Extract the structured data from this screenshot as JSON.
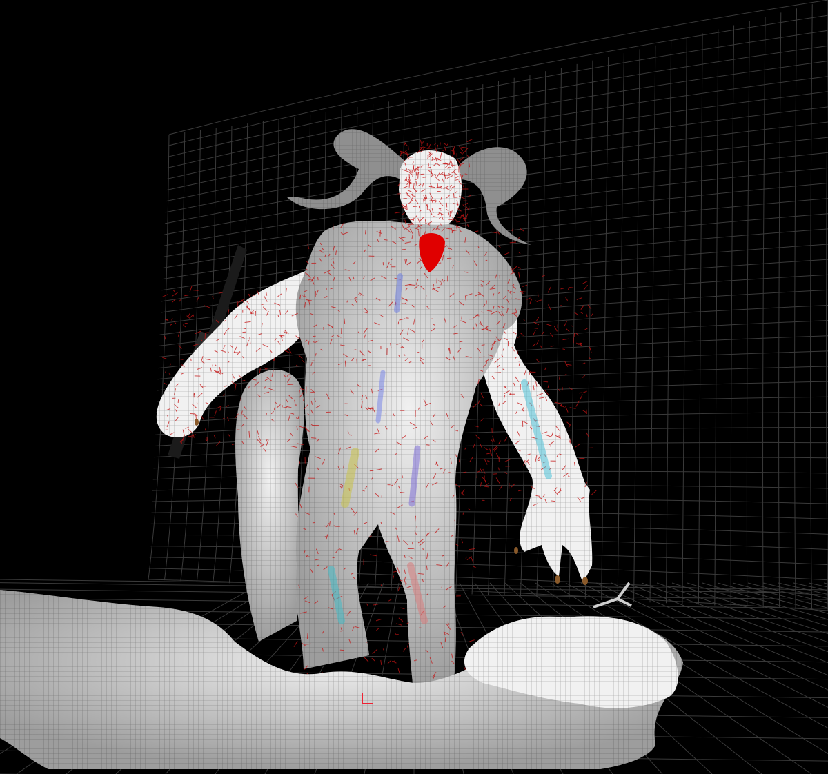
{
  "viewport": {
    "background": "#000000",
    "grid_color": "#3a3a3a",
    "mesh_color": "#f2f2f2",
    "wire_color": "#8a8a8a",
    "hair_color": "#c41414",
    "horn_color": "#8c8c8c",
    "tongue_color": "#e00000",
    "weapon_color": "#1e1e1e"
  },
  "scene": {
    "objects": [
      {
        "name": "backdrop",
        "icon": "cyclorama-grid"
      },
      {
        "name": "floor-grid",
        "icon": "grid-plane"
      },
      {
        "name": "demon",
        "icon": "wireframe-figure"
      },
      {
        "name": "horns",
        "icon": "curled-horn"
      },
      {
        "name": "tongue",
        "icon": "tongue"
      },
      {
        "name": "weapon",
        "icon": "club"
      },
      {
        "name": "rock-pillar",
        "icon": "rock"
      },
      {
        "name": "base-rocks",
        "icon": "rock"
      },
      {
        "name": "fallen-victim",
        "icon": "figure"
      },
      {
        "name": "pivot-gizmo",
        "icon": "axis-gizmo"
      }
    ]
  }
}
